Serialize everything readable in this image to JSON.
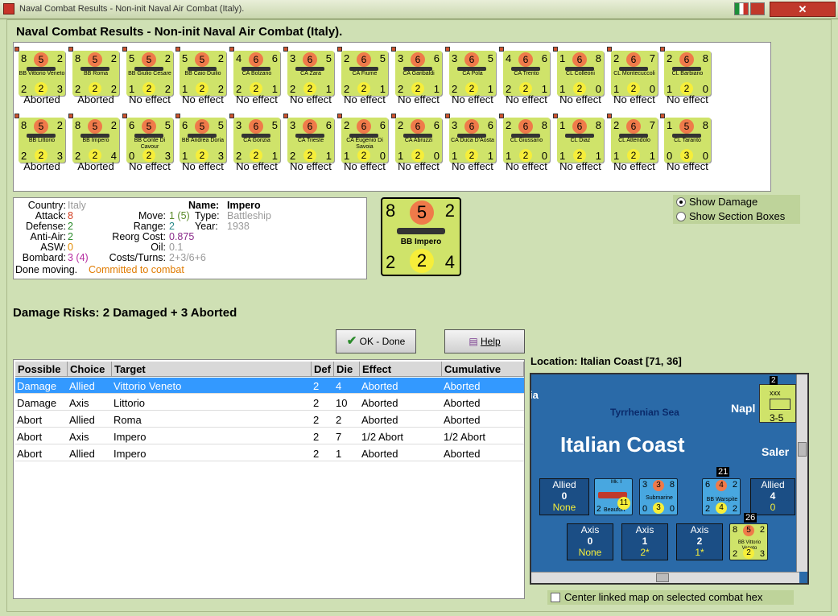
{
  "window": {
    "title": "Naval Combat Results - Non-init Naval Air Combat (Italy)."
  },
  "heading": "Naval Combat Results - Non-init Naval Air Combat (Italy).",
  "results": [
    {
      "a": "8",
      "t": "5",
      "b": "2",
      "name": "BB Vittorio Veneto",
      "c": "2",
      "m": "2",
      "d": "3",
      "result": "Aborted"
    },
    {
      "a": "8",
      "t": "5",
      "b": "2",
      "name": "BB Roma",
      "c": "2",
      "m": "2",
      "d": "2",
      "result": "Aborted"
    },
    {
      "a": "5",
      "t": "5",
      "b": "2",
      "name": "BB Giulio Cesare",
      "c": "1",
      "m": "2",
      "d": "2",
      "result": "No effect"
    },
    {
      "a": "5",
      "t": "5",
      "b": "2",
      "name": "BB Caio Duilio",
      "c": "1",
      "m": "2",
      "d": "2",
      "result": "No effect"
    },
    {
      "a": "4",
      "t": "6",
      "b": "6",
      "name": "CA Bolzano",
      "c": "2",
      "m": "2",
      "d": "1",
      "result": "No effect"
    },
    {
      "a": "3",
      "t": "6",
      "b": "5",
      "name": "CA Zara",
      "c": "2",
      "m": "2",
      "d": "1",
      "result": "No effect"
    },
    {
      "a": "2",
      "t": "6",
      "b": "5",
      "name": "CA Fiume",
      "c": "2",
      "m": "2",
      "d": "1",
      "result": "No effect"
    },
    {
      "a": "3",
      "t": "6",
      "b": "6",
      "name": "CA Garibaldi",
      "c": "2",
      "m": "2",
      "d": "1",
      "result": "No effect"
    },
    {
      "a": "3",
      "t": "6",
      "b": "5",
      "name": "CA Pola",
      "c": "2",
      "m": "2",
      "d": "1",
      "result": "No effect"
    },
    {
      "a": "4",
      "t": "6",
      "b": "6",
      "name": "CA Trento",
      "c": "2",
      "m": "2",
      "d": "1",
      "result": "No effect"
    },
    {
      "a": "1",
      "t": "6",
      "b": "8",
      "name": "CL Colleoni",
      "c": "1",
      "m": "2",
      "d": "0",
      "result": "No effect"
    },
    {
      "a": "2",
      "t": "6",
      "b": "7",
      "name": "CL Montecuccoli",
      "c": "1",
      "m": "2",
      "d": "0",
      "result": "No effect"
    },
    {
      "a": "2",
      "t": "6",
      "b": "8",
      "name": "CL Barbiano",
      "c": "1",
      "m": "2",
      "d": "0",
      "result": "No effect"
    },
    {
      "a": "8",
      "t": "5",
      "b": "2",
      "name": "BB Littorio",
      "c": "2",
      "m": "2",
      "d": "3",
      "result": "Aborted"
    },
    {
      "a": "8",
      "t": "5",
      "b": "2",
      "name": "BB Impero",
      "c": "2",
      "m": "2",
      "d": "4",
      "result": "Aborted"
    },
    {
      "a": "6",
      "t": "5",
      "b": "5",
      "name": "BB Conte Di Cavour",
      "c": "0",
      "m": "2",
      "d": "3",
      "result": "No effect"
    },
    {
      "a": "6",
      "t": "5",
      "b": "5",
      "name": "BB Andrea Doria",
      "c": "1",
      "m": "2",
      "d": "3",
      "result": "No effect"
    },
    {
      "a": "3",
      "t": "6",
      "b": "5",
      "name": "CA Gorizia",
      "c": "2",
      "m": "2",
      "d": "1",
      "result": "No effect"
    },
    {
      "a": "3",
      "t": "6",
      "b": "6",
      "name": "CA Trieste",
      "c": "2",
      "m": "2",
      "d": "1",
      "result": "No effect"
    },
    {
      "a": "2",
      "t": "6",
      "b": "6",
      "name": "CA Eugenio Di Savoia",
      "c": "1",
      "m": "2",
      "d": "0",
      "result": "No effect"
    },
    {
      "a": "2",
      "t": "6",
      "b": "6",
      "name": "CA Abruzzi",
      "c": "1",
      "m": "2",
      "d": "0",
      "result": "No effect"
    },
    {
      "a": "3",
      "t": "6",
      "b": "6",
      "name": "CA Duca D'Aosta",
      "c": "1",
      "m": "2",
      "d": "1",
      "result": "No effect"
    },
    {
      "a": "2",
      "t": "6",
      "b": "8",
      "name": "CL Giussano",
      "c": "1",
      "m": "2",
      "d": "0",
      "result": "No effect"
    },
    {
      "a": "1",
      "t": "6",
      "b": "8",
      "name": "CL Diaz",
      "c": "1",
      "m": "2",
      "d": "1",
      "result": "No effect"
    },
    {
      "a": "2",
      "t": "6",
      "b": "7",
      "name": "CL Attendolo",
      "c": "1",
      "m": "2",
      "d": "1",
      "result": "No effect"
    },
    {
      "a": "1",
      "t": "5",
      "b": "8",
      "name": "CL Taranto",
      "c": "0",
      "m": "3",
      "d": "0",
      "result": "No effect"
    }
  ],
  "info": {
    "country_label": "Country:",
    "country": "Italy",
    "attack_label": "Attack:",
    "attack": "8",
    "defense_label": "Defense:",
    "defense": "2",
    "antiair_label": "Anti-Air:",
    "antiair": "2",
    "asw_label": "ASW:",
    "asw": "0",
    "bombard_label": "Bombard:",
    "bombard": "3 (4)",
    "name_label": "Name:",
    "name": "Impero",
    "move_label": "Move:",
    "move": "1 (5)",
    "type_label": "Type:",
    "type": "Battleship",
    "range_label": "Range:",
    "range": "2",
    "year_label": "Year:",
    "year": "1938",
    "reorg_label": "Reorg Cost:",
    "reorg": "0.875",
    "oil_label": "Oil:",
    "oil": "0.1",
    "costs_label": "Costs/Turns:",
    "costs": "2+3/6+6",
    "status": "Done moving.",
    "status2": "Committed to combat"
  },
  "big_counter": {
    "tl": "8",
    "tc": "5",
    "tr": "2",
    "name": "BB Impero",
    "bl": "2",
    "bc": "2",
    "br": "4"
  },
  "options": {
    "show_damage": "Show Damage",
    "show_sections": "Show Section Boxes"
  },
  "damage_risks": "Damage Risks:  2 Damaged + 3 Aborted",
  "buttons": {
    "ok": "OK - Done",
    "help": "Help"
  },
  "table": {
    "headers": [
      "Possible",
      "Choice",
      "Target",
      "Def",
      "Die",
      "Effect",
      "Cumulative"
    ],
    "rows": [
      [
        "Damage",
        "Allied",
        "Vittorio Veneto",
        "2",
        "4",
        "Aborted",
        "Aborted"
      ],
      [
        "Damage",
        "Axis",
        "Littorio",
        "2",
        "10",
        "Aborted",
        "Aborted"
      ],
      [
        "Abort",
        "Allied",
        "Roma",
        "2",
        "2",
        "Aborted",
        "Aborted"
      ],
      [
        "Abort",
        "Axis",
        "Impero",
        "2",
        "7",
        "1/2 Abort",
        "1/2 Abort"
      ],
      [
        "Abort",
        "Allied",
        "Impero",
        "2",
        "1",
        "Aborted",
        "Aborted"
      ]
    ]
  },
  "location": "Location:  Italian Coast [71, 36]",
  "map": {
    "title": "Italian Coast",
    "sea": "Tyrrhenian Sea",
    "ia": "ia",
    "napl": "Napl",
    "saler": "Saler",
    "xxx": "xxx",
    "xxx_num": "2",
    "xxx_val": "3-5",
    "allied_l_label": "Allied",
    "allied_l_num": "0",
    "allied_l_sub": "None",
    "allied_r_label": "Allied",
    "allied_r_num": "4",
    "allied_r_sub": "0",
    "axis1_label": "Axis",
    "axis1_num": "0",
    "axis1_sub": "None",
    "axis2_label": "Axis",
    "axis2_num": "1",
    "axis2_sub": "2*",
    "axis3_label": "Axis",
    "axis3_num": "2",
    "axis3_sub": "1*",
    "beaufort": "Beaufort",
    "beaufort_a": "2",
    "beaufort_b": "11",
    "beaufort_mk": "Mk. I",
    "sub_label": "Submarine",
    "sub_t": "3",
    "sub_l": "3",
    "sub_r": "8",
    "sub_c": "0",
    "sub_m": "3",
    "sub_d": "0",
    "warspite": "BB Warspite",
    "war_t": "4",
    "war_l": "6",
    "war_r": "2",
    "war_c": "2",
    "war_m": "4",
    "war_d": "2",
    "war_stack": "21",
    "vv": "BB Vittorio Veneto",
    "vv_t": "5",
    "vv_l": "8",
    "vv_r": "2",
    "vv_c": "2",
    "vv_m": "2",
    "vv_d": "3",
    "vv_stack": "26"
  },
  "center_check": "Center linked map on selected combat hex"
}
